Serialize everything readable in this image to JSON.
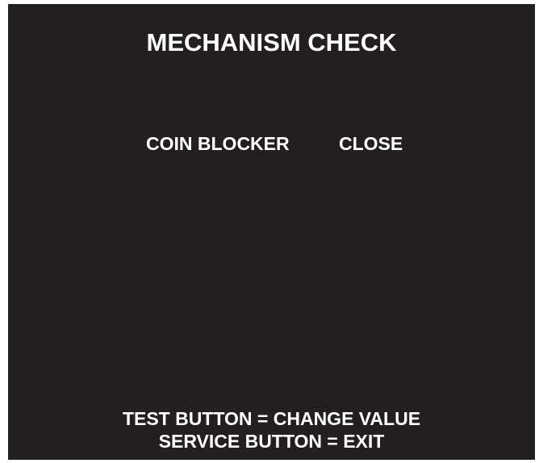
{
  "screen": {
    "title": "MECHANISM CHECK",
    "setting": {
      "label": "COIN BLOCKER",
      "value": "CLOSE"
    },
    "instructions": [
      "TEST BUTTON = CHANGE VALUE",
      "SERVICE BUTTON = EXIT"
    ]
  },
  "colors": {
    "background": "#231f20",
    "text": "#ffffff",
    "page": "#ffffff"
  }
}
